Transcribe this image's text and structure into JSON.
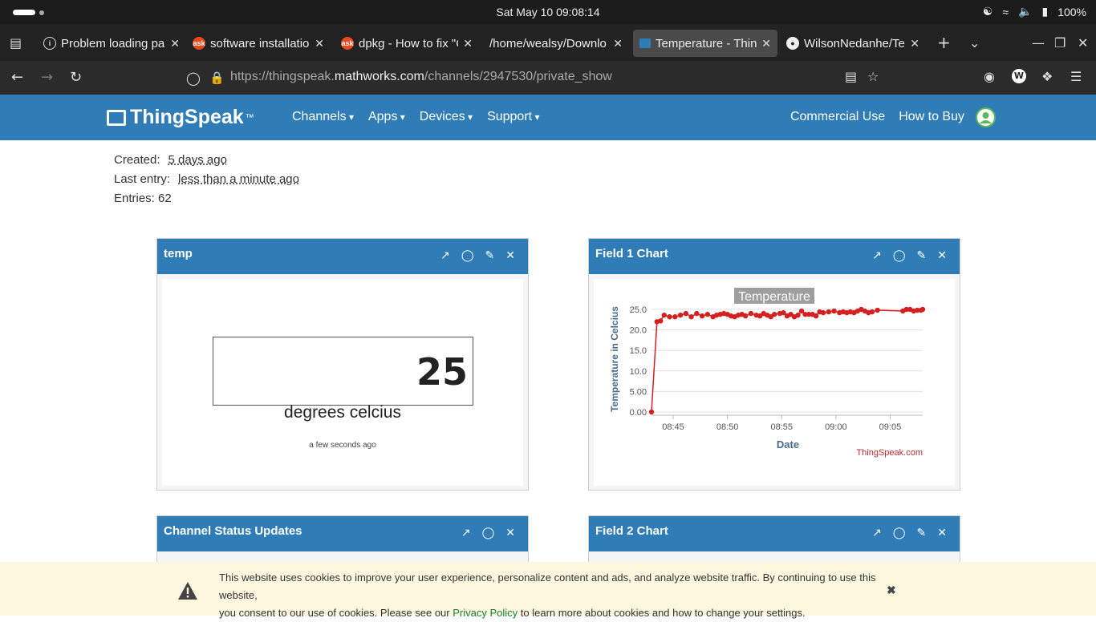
{
  "system": {
    "clock": "Sat May 10  09:08:14",
    "battery": "100%"
  },
  "tabs": [
    {
      "title": "Problem loading pa",
      "icon": "info-icon"
    },
    {
      "title": "software installatio",
      "icon": "askubuntu-icon"
    },
    {
      "title": "dpkg - How to fix \"C",
      "icon": "askubuntu-icon"
    },
    {
      "title": "/home/wealsy/Downlo",
      "icon": "folder-icon"
    },
    {
      "title": "Temperature - Thin",
      "icon": "thingspeak-icon"
    },
    {
      "title": "WilsonNedanhe/Te",
      "icon": "github-icon"
    }
  ],
  "urlbar": {
    "url_prefix": "https://thingspeak.",
    "url_domain": "mathworks.com",
    "url_path": "/channels/2947530/private_show"
  },
  "site": {
    "logo": "ThingSpeak",
    "logo_tm": "™",
    "menu": [
      "Channels",
      "Apps",
      "Devices",
      "Support"
    ],
    "right": [
      "Commercial Use",
      "How to Buy"
    ]
  },
  "meta": {
    "created_label": "Created:",
    "created_value": "5 days ago",
    "last_label": "Last entry:",
    "last_value": "less than a minute ago",
    "entries": "Entries: 62"
  },
  "panels": {
    "temp": {
      "title": "temp",
      "value": "25",
      "units": "degrees celcius",
      "ago": "a few seconds ago"
    },
    "field1": {
      "title": "Field 1 Chart"
    },
    "status": {
      "title": "Channel Status Updates"
    },
    "field2": {
      "title": "Field 2 Chart"
    }
  },
  "chart_data": {
    "type": "line",
    "title": "Temperature",
    "xlabel": "Date",
    "ylabel": "Temperature in Celcius",
    "credit": "ThingSpeak.com",
    "color": "#d62020",
    "ylim": [
      0,
      25
    ],
    "yticks": [
      "0.00",
      "5.00",
      "10.0",
      "15.0",
      "20.0",
      "25.0"
    ],
    "xticks": [
      "08:45",
      "08:50",
      "08:55",
      "09:00",
      "09:05"
    ],
    "xlim_minutes": [
      "08:43",
      "09:08"
    ],
    "x": [
      "08:43:00",
      "08:43:30",
      "08:43:50",
      "08:44:10",
      "08:44:40",
      "08:45:10",
      "08:45:40",
      "08:46:10",
      "08:46:40",
      "08:47:10",
      "08:47:40",
      "08:48:10",
      "08:48:40",
      "08:49:00",
      "08:49:20",
      "08:49:40",
      "08:50:00",
      "08:50:20",
      "08:50:40",
      "08:51:00",
      "08:51:20",
      "08:51:40",
      "08:52:10",
      "08:52:40",
      "08:53:00",
      "08:53:20",
      "08:53:40",
      "08:54:00",
      "08:54:20",
      "08:54:50",
      "08:55:10",
      "08:55:30",
      "08:55:50",
      "08:56:10",
      "08:56:30",
      "08:56:50",
      "08:57:10",
      "08:57:30",
      "08:57:50",
      "08:58:10",
      "08:58:30",
      "08:58:50",
      "08:59:20",
      "08:59:50",
      "09:00:20",
      "09:00:40",
      "09:01:00",
      "09:01:20",
      "09:01:40",
      "09:02:00",
      "09:02:20",
      "09:02:40",
      "09:03:00",
      "09:03:20",
      "09:03:50",
      "09:06:10",
      "09:06:30",
      "09:06:50",
      "09:07:10",
      "09:07:30",
      "09:07:50",
      "09:08:00"
    ],
    "y": [
      0.0,
      22.0,
      22.2,
      23.6,
      23.2,
      23.2,
      23.6,
      24.0,
      23.2,
      24.0,
      23.4,
      23.8,
      23.2,
      23.6,
      23.8,
      24.0,
      23.8,
      23.4,
      23.2,
      23.6,
      23.8,
      23.4,
      24.0,
      23.6,
      23.4,
      24.0,
      23.6,
      23.2,
      23.8,
      24.0,
      24.2,
      23.4,
      23.8,
      23.2,
      23.6,
      24.6,
      23.8,
      23.8,
      23.8,
      23.4,
      24.4,
      24.2,
      24.4,
      24.6,
      24.2,
      24.4,
      24.2,
      24.4,
      24.2,
      24.6,
      25.0,
      24.6,
      24.2,
      24.4,
      24.8,
      24.6,
      25.0,
      25.0,
      24.6,
      24.8,
      24.8,
      25.0
    ]
  },
  "cookie": {
    "text1": "This website uses cookies to improve your user experience, personalize content and ads, and analyze website traffic. By continuing to use this website,",
    "text2": "you consent to our use of cookies. Please see our",
    "link": "Privacy Policy",
    "text3": "to learn more about cookies and how to change your settings."
  }
}
